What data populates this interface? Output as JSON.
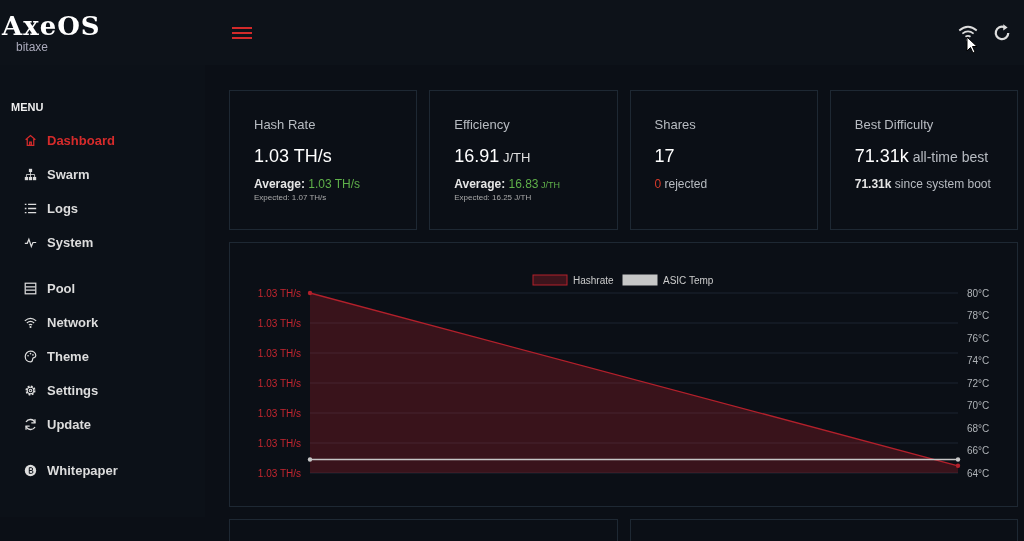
{
  "header": {
    "logo": "AxeOS",
    "logo_subtitle": "bitaxe"
  },
  "sidebar": {
    "heading": "MENU",
    "groups": [
      [
        {
          "label": "Dashboard",
          "selected": true
        },
        {
          "label": "Swarm",
          "selected": false
        },
        {
          "label": "Logs",
          "selected": false
        },
        {
          "label": "System",
          "selected": false
        }
      ],
      [
        {
          "label": "Pool",
          "selected": false
        },
        {
          "label": "Network",
          "selected": false
        },
        {
          "label": "Theme",
          "selected": false
        },
        {
          "label": "Settings",
          "selected": false
        },
        {
          "label": "Update",
          "selected": false
        }
      ],
      [
        {
          "label": "Whitepaper",
          "selected": false
        }
      ]
    ]
  },
  "cards": [
    {
      "title": "Hash Rate",
      "main": [
        {
          "text": "1.03 TH/s",
          "kind": "strong"
        }
      ],
      "lines": [
        [
          {
            "text": "Average: ",
            "kind": "label"
          },
          {
            "text": "1.03 TH/s",
            "kind": "good"
          }
        ]
      ],
      "note": "Expected: 1.07 TH/s"
    },
    {
      "title": "Efficiency",
      "main": [
        {
          "text": "16.91",
          "kind": "strong"
        },
        {
          "text": " J/TH",
          "kind": "unit"
        }
      ],
      "lines": [
        [
          {
            "text": "Average: ",
            "kind": "label"
          },
          {
            "text": "16.83",
            "kind": "good"
          },
          {
            "text": " J/TH",
            "kind": "goodunit"
          }
        ]
      ],
      "note": "Expected: 16.25 J/TH"
    },
    {
      "title": "Shares",
      "main": [
        {
          "text": "17",
          "kind": "strong"
        }
      ],
      "lines": [
        [
          {
            "text": "0",
            "kind": "bad"
          },
          {
            "text": " rejected",
            "kind": "muted"
          }
        ]
      ]
    },
    {
      "title": "Best Difficulty",
      "main": [
        {
          "text": "71.31k",
          "kind": "strong"
        },
        {
          "text": " all-time best",
          "kind": "muted"
        }
      ],
      "lines": [
        [
          {
            "text": "71.31k",
            "kind": "label"
          },
          {
            "text": " since system boot",
            "kind": "muted"
          }
        ]
      ]
    }
  ],
  "chart": {
    "hashrate_axis_labels": [
      "1.03 TH/s",
      "1.03 TH/s",
      "1.03 TH/s",
      "1.03 TH/s",
      "1.03 TH/s",
      "1.03 TH/s",
      "1.03 TH/s"
    ],
    "chart_data": {
      "type": "area",
      "legend": "top",
      "series": [
        {
          "name": "Hashrate",
          "color": "#b3202b",
          "values": [
            null,
            null
          ],
          "axis": "y2"
        },
        {
          "name": "ASIC Temp",
          "type": "line",
          "color": "#c6c6c6",
          "values": [
            65.2,
            65.2
          ]
        }
      ],
      "ylim": [
        64,
        80
      ],
      "yticks": [
        {
          "value": 80,
          "label": "80°C"
        },
        {
          "value": 78,
          "label": "78°C"
        },
        {
          "value": 76,
          "label": "76°C"
        },
        {
          "value": 74,
          "label": "74°C"
        },
        {
          "value": 72,
          "label": "72°C"
        },
        {
          "value": 70,
          "label": "70°C"
        },
        {
          "value": 68,
          "label": "68°C"
        },
        {
          "value": 66,
          "label": "66°C"
        },
        {
          "value": 64,
          "label": "64°C"
        }
      ]
    }
  }
}
